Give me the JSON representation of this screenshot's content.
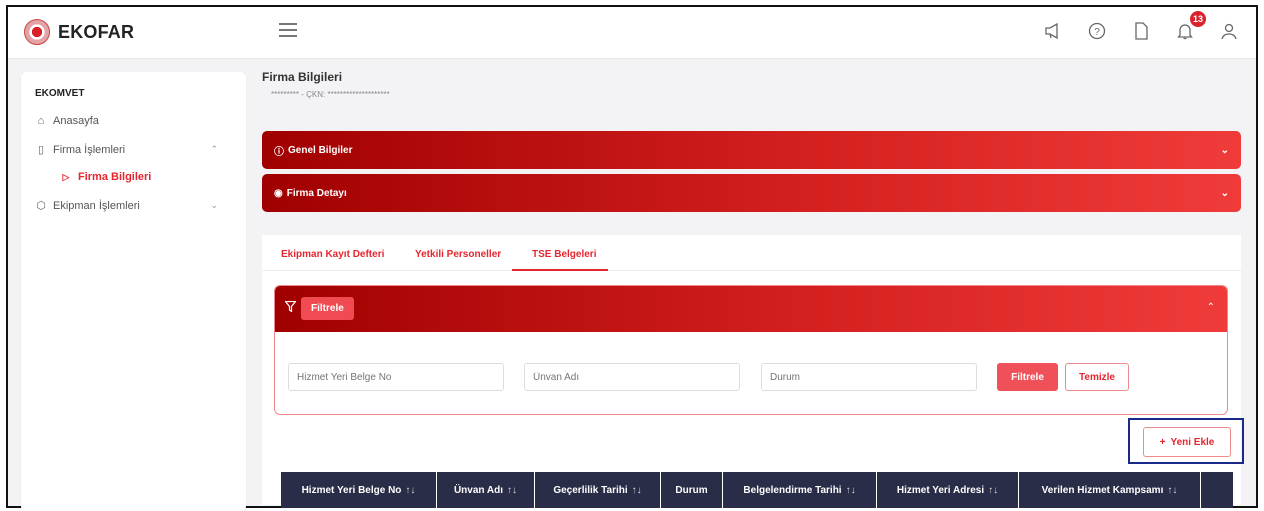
{
  "app": {
    "name": "EKOFAR",
    "notification_count": "13"
  },
  "sidebar": {
    "section_title": "EKOMVET",
    "items": [
      {
        "label": "Anasayfa",
        "icon": "home-icon"
      },
      {
        "label": "Firma İşlemleri",
        "icon": "building-icon"
      },
      {
        "label": "Firma Bilgileri",
        "icon": "triangle-right-icon",
        "active": true
      },
      {
        "label": "Ekipman İşlemleri",
        "icon": "box-icon"
      }
    ]
  },
  "page": {
    "title": "Firma Bilgileri",
    "subtitle": "********* - ÇKN: ********************"
  },
  "accordions": [
    {
      "label": "Genel Bilgiler",
      "icon": "info-icon"
    },
    {
      "label": "Firma Detayı",
      "icon": "eye-icon"
    }
  ],
  "tabs": [
    {
      "label": "Ekipman Kayıt Defteri"
    },
    {
      "label": "Yetkili Personeller"
    },
    {
      "label": "TSE Belgeleri",
      "active": true
    }
  ],
  "filter": {
    "head_button": "Filtrele",
    "fields": [
      {
        "placeholder": "Hizmet Yeri Belge No"
      },
      {
        "placeholder": "Ünvan Adı"
      },
      {
        "placeholder": "Durum"
      }
    ],
    "apply_label": "Filtrele",
    "clear_label": "Temizle"
  },
  "add_button": {
    "label": "Yeni Ekle"
  },
  "table": {
    "columns": [
      "Hizmet Yeri Belge No",
      "Ünvan Adı",
      "Geçerlilik Tarihi",
      "Durum",
      "Belgelendirme Tarihi",
      "Hizmet Yeri Adresi",
      "Verilen Hizmet Kampsamı"
    ],
    "sort_glyph": "↑↓"
  },
  "colors": {
    "accent": "#e5252f",
    "header_dark": "#2a2d47",
    "gradient_start": "#a00000",
    "gradient_end": "#f03b3b"
  }
}
